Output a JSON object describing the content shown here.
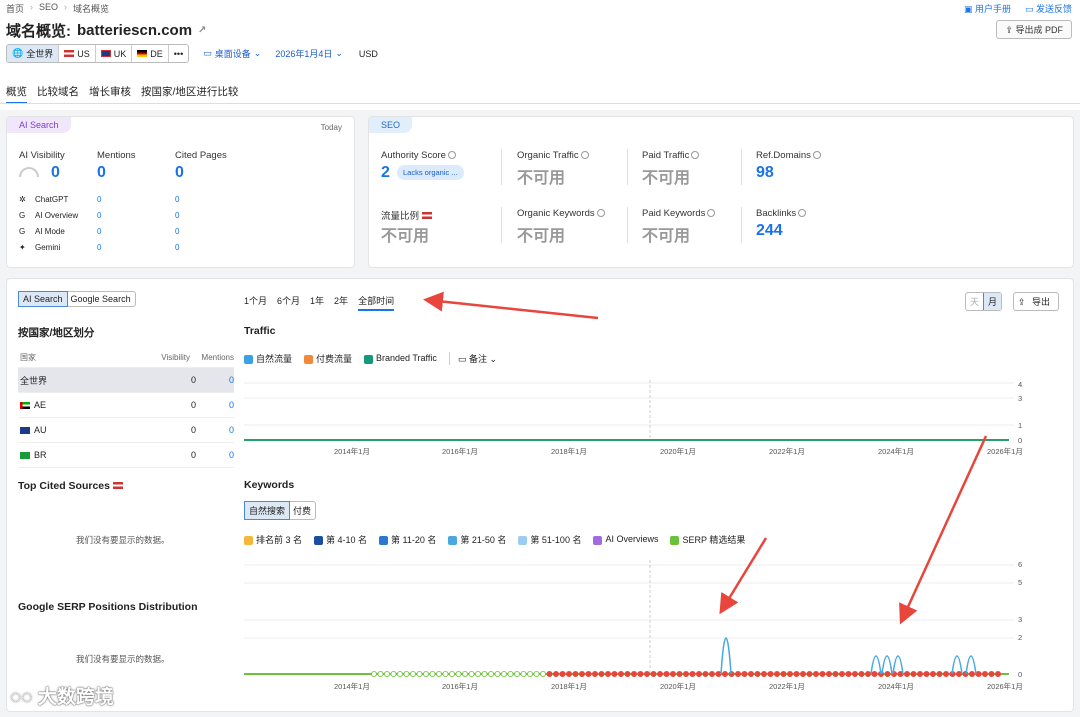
{
  "breadcrumb": [
    "首页",
    "SEO",
    "域名概览"
  ],
  "title": {
    "label": "域名概览:",
    "domain": "batteriescn.com"
  },
  "toplinks": {
    "manual": "用户手册",
    "feedback": "发送反馈"
  },
  "pdf": "导出成 PDF",
  "filters": {
    "world": "全世界",
    "us": "US",
    "uk": "UK",
    "de": "DE",
    "more": "•••",
    "device": "桌面设备",
    "date": "2026年1月4日",
    "currency": "USD"
  },
  "tabs": [
    "概览",
    "比较域名",
    "增长审核",
    "按国家/地区进行比较"
  ],
  "ai": {
    "pill": "AI Search",
    "today": "Today",
    "vis_label": "AI Visibility",
    "vis": "0",
    "men_label": "Mentions",
    "men": "0",
    "cited_label": "Cited Pages",
    "cited": "0",
    "rows": [
      {
        "name": "ChatGPT",
        "m": "0",
        "c": "0"
      },
      {
        "name": "AI Overview",
        "m": "0",
        "c": "0"
      },
      {
        "name": "AI Mode",
        "m": "0",
        "c": "0"
      },
      {
        "name": "Gemini",
        "m": "0",
        "c": "0"
      }
    ]
  },
  "seo": {
    "pill": "SEO",
    "as_label": "Authority Score",
    "as": "2",
    "as_badge": "Lacks organic ...",
    "ot_label": "Organic Traffic",
    "ot": "不可用",
    "pt_label": "Paid Traffic",
    "pt": "不可用",
    "rd_label": "Ref.Domains",
    "rd": "98",
    "share_label": "流量比例",
    "share": "不可用",
    "ok_label": "Organic Keywords",
    "ok": "不可用",
    "pk_label": "Paid Keywords",
    "pk": "不可用",
    "bl_label": "Backlinks",
    "bl": "244"
  },
  "lower": {
    "toggle": [
      "AI Search",
      "Google Search"
    ],
    "periods": [
      "1个月",
      "6个月",
      "1年",
      "2年",
      "全部时间"
    ],
    "day": "天",
    "month": "月",
    "export": "导出",
    "country_title": "按国家/地区划分",
    "cols": [
      "国家",
      "Visibility",
      "Mentions"
    ],
    "countries": [
      {
        "name": "全世界",
        "v": "0",
        "m": "0"
      },
      {
        "name": "AE",
        "v": "0",
        "m": "0"
      },
      {
        "name": "AU",
        "v": "0",
        "m": "0"
      },
      {
        "name": "BR",
        "v": "0",
        "m": "0"
      }
    ],
    "cited_title": "Top Cited Sources",
    "nodata": "我们没有要显示的数据。",
    "serp_title": "Google SERP Positions Distribution",
    "traffic_title": "Traffic",
    "traffic_legend": [
      "自然流量",
      "付费流量",
      "Branded Traffic",
      "备注"
    ],
    "kw_title": "Keywords",
    "kw_toggle": [
      "自然搜索",
      "付费"
    ],
    "kw_legend": [
      "排名前 3 名",
      "第 4-10 名",
      "第 11-20 名",
      "第 21-50 名",
      "第 51-100 名",
      "AI Overviews",
      "SERP 精选结果"
    ],
    "xticks": [
      "2014年1月",
      "2016年1月",
      "2018年1月",
      "2020年1月",
      "2022年1月",
      "2024年1月",
      "2026年1月"
    ],
    "traffic_y": [
      "4",
      "3",
      "1",
      "0"
    ],
    "kw_y": [
      "6",
      "5",
      "3",
      "2",
      "0"
    ]
  },
  "watermark": "大数跨境",
  "colors": {
    "accent": "#1a73e8",
    "green": "#25a26b",
    "red": "#e8453c"
  }
}
